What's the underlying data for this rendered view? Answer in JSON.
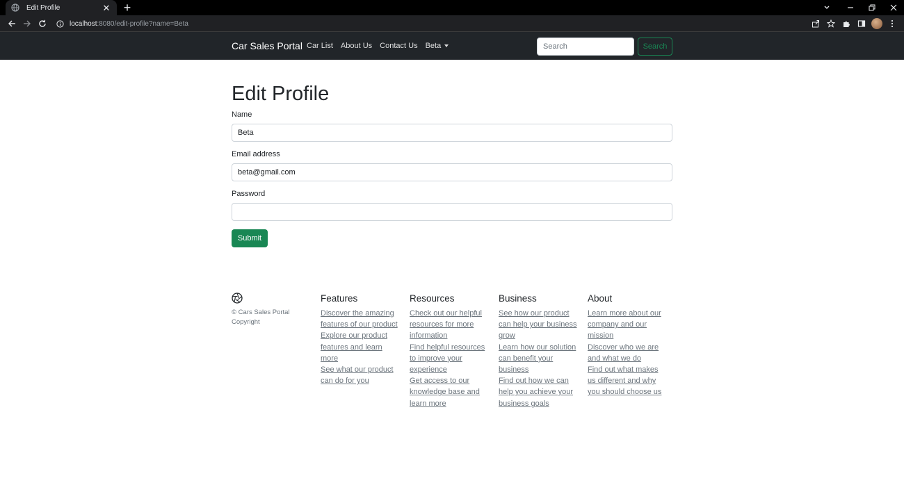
{
  "browser": {
    "tab_title": "Edit Profile",
    "tab_close": "✕",
    "new_tab": "+",
    "url_host": "localhost",
    "url_path": ":8080/edit-profile?name=Beta"
  },
  "navbar": {
    "brand": "Car Sales Portal",
    "links": [
      "Car List",
      "About Us",
      "Contact Us"
    ],
    "user_menu": "Beta",
    "search_placeholder": "Search",
    "search_button": "Search"
  },
  "form": {
    "title": "Edit Profile",
    "name_label": "Name",
    "name_value": "Beta",
    "email_label": "Email address",
    "email_value": "beta@gmail.com",
    "password_label": "Password",
    "password_value": "",
    "submit_label": "Submit"
  },
  "footer": {
    "copyright": "© Cars Sales Portal Copyright",
    "columns": [
      {
        "heading": "Features",
        "links": [
          "Discover the amazing features of our product",
          "Explore our product features and learn more",
          "See what our product can do for you"
        ]
      },
      {
        "heading": "Resources",
        "links": [
          "Check out our helpful resources for more information",
          "Find helpful resources to improve your experience",
          "Get access to our knowledge base and learn more"
        ]
      },
      {
        "heading": "Business",
        "links": [
          "See how our product can help your business grow",
          "Learn how our solution can benefit your business",
          "Find out how we can help you achieve your business goals"
        ]
      },
      {
        "heading": "About",
        "links": [
          "Learn more about our company and our mission",
          "Discover who we are and what we do",
          "Find out what makes us different and why you should choose us"
        ]
      }
    ]
  },
  "colors": {
    "navbar_bg": "#212529",
    "success": "#198754",
    "muted_text": "#6c757d"
  }
}
